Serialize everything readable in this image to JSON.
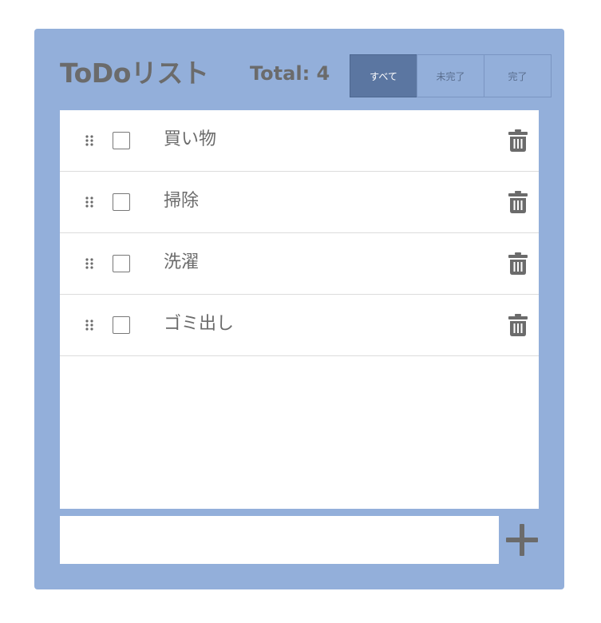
{
  "header": {
    "title": "ToDoリスト",
    "total_label": "Total: 4"
  },
  "filters": [
    {
      "label": "すべて",
      "active": true
    },
    {
      "label": "未完了",
      "active": false
    },
    {
      "label": "完了",
      "active": false
    }
  ],
  "todos": [
    {
      "label": "買い物",
      "done": false
    },
    {
      "label": "掃除",
      "done": false
    },
    {
      "label": "洗濯",
      "done": false
    },
    {
      "label": "ゴミ出し",
      "done": false
    }
  ],
  "new_todo": {
    "value": "",
    "placeholder": ""
  },
  "icons": {
    "drag": "drag-handle-icon",
    "delete": "trash-icon",
    "add": "plus-icon"
  },
  "colors": {
    "panel": "#93afda",
    "active_filter": "#5b76a1",
    "text": "#6b6b6b"
  }
}
